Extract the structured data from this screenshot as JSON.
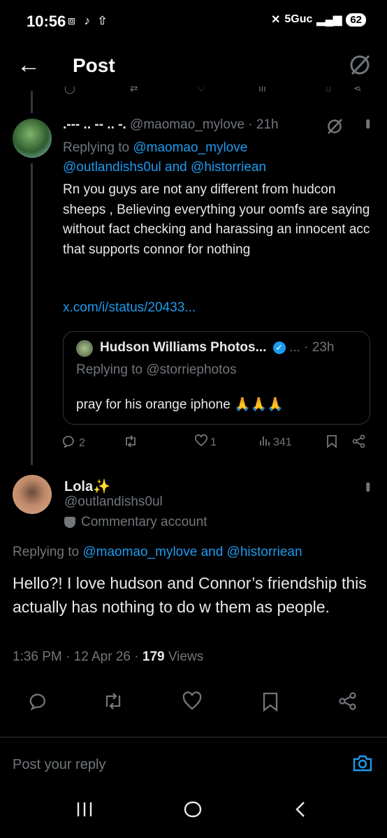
{
  "status_bar": {
    "time": "10:56",
    "left_icons": "⧈ ♪ ⇧",
    "network": "5Guc",
    "battery": "62"
  },
  "header": {
    "title": "Post"
  },
  "tweet1": {
    "display_name": ".--- .. -- .. -.",
    "handle": "@maomao_mylove",
    "time": "21h",
    "replying_prefix": "Replying to",
    "replying_user1": "@maomao_mylove",
    "replying_user2": "@outlandishs0ul",
    "replying_and": "and",
    "replying_user3": "@historriean",
    "body": "Rn you guys are not any different from hudcon sheeps , Believing everything your oomfs are saying without fact checking and harassing an innocent acc that supports connor for nothing",
    "link": "x.com/i/status/20433...",
    "quote": {
      "display_name": "Hudson Williams Photos...",
      "dots": "...",
      "time": "23h",
      "replying": "Replying to @storriephotos",
      "body": "pray for his orange iphone 🙏🙏🙏"
    },
    "actions": {
      "replies": "2",
      "likes": "1",
      "views": "341"
    }
  },
  "tweet2": {
    "display_name": "Lola✨",
    "handle": "@outlandishs0ul",
    "badge": "Commentary account",
    "replying_prefix": "Replying to",
    "replying_users": "@maomao_mylove and @historriean",
    "body": "Hello?! I love hudson and Connor’s friendship this actually has nothing to do w them as people.",
    "timestamp": "1:36 PM · 12 Apr 26 · ",
    "views_count": "179",
    "views_label": " Views"
  },
  "reply_box": {
    "placeholder": "Post your reply"
  },
  "colors": {
    "accent": "#1d9bf0",
    "muted": "#71767b",
    "background": "#000000"
  }
}
